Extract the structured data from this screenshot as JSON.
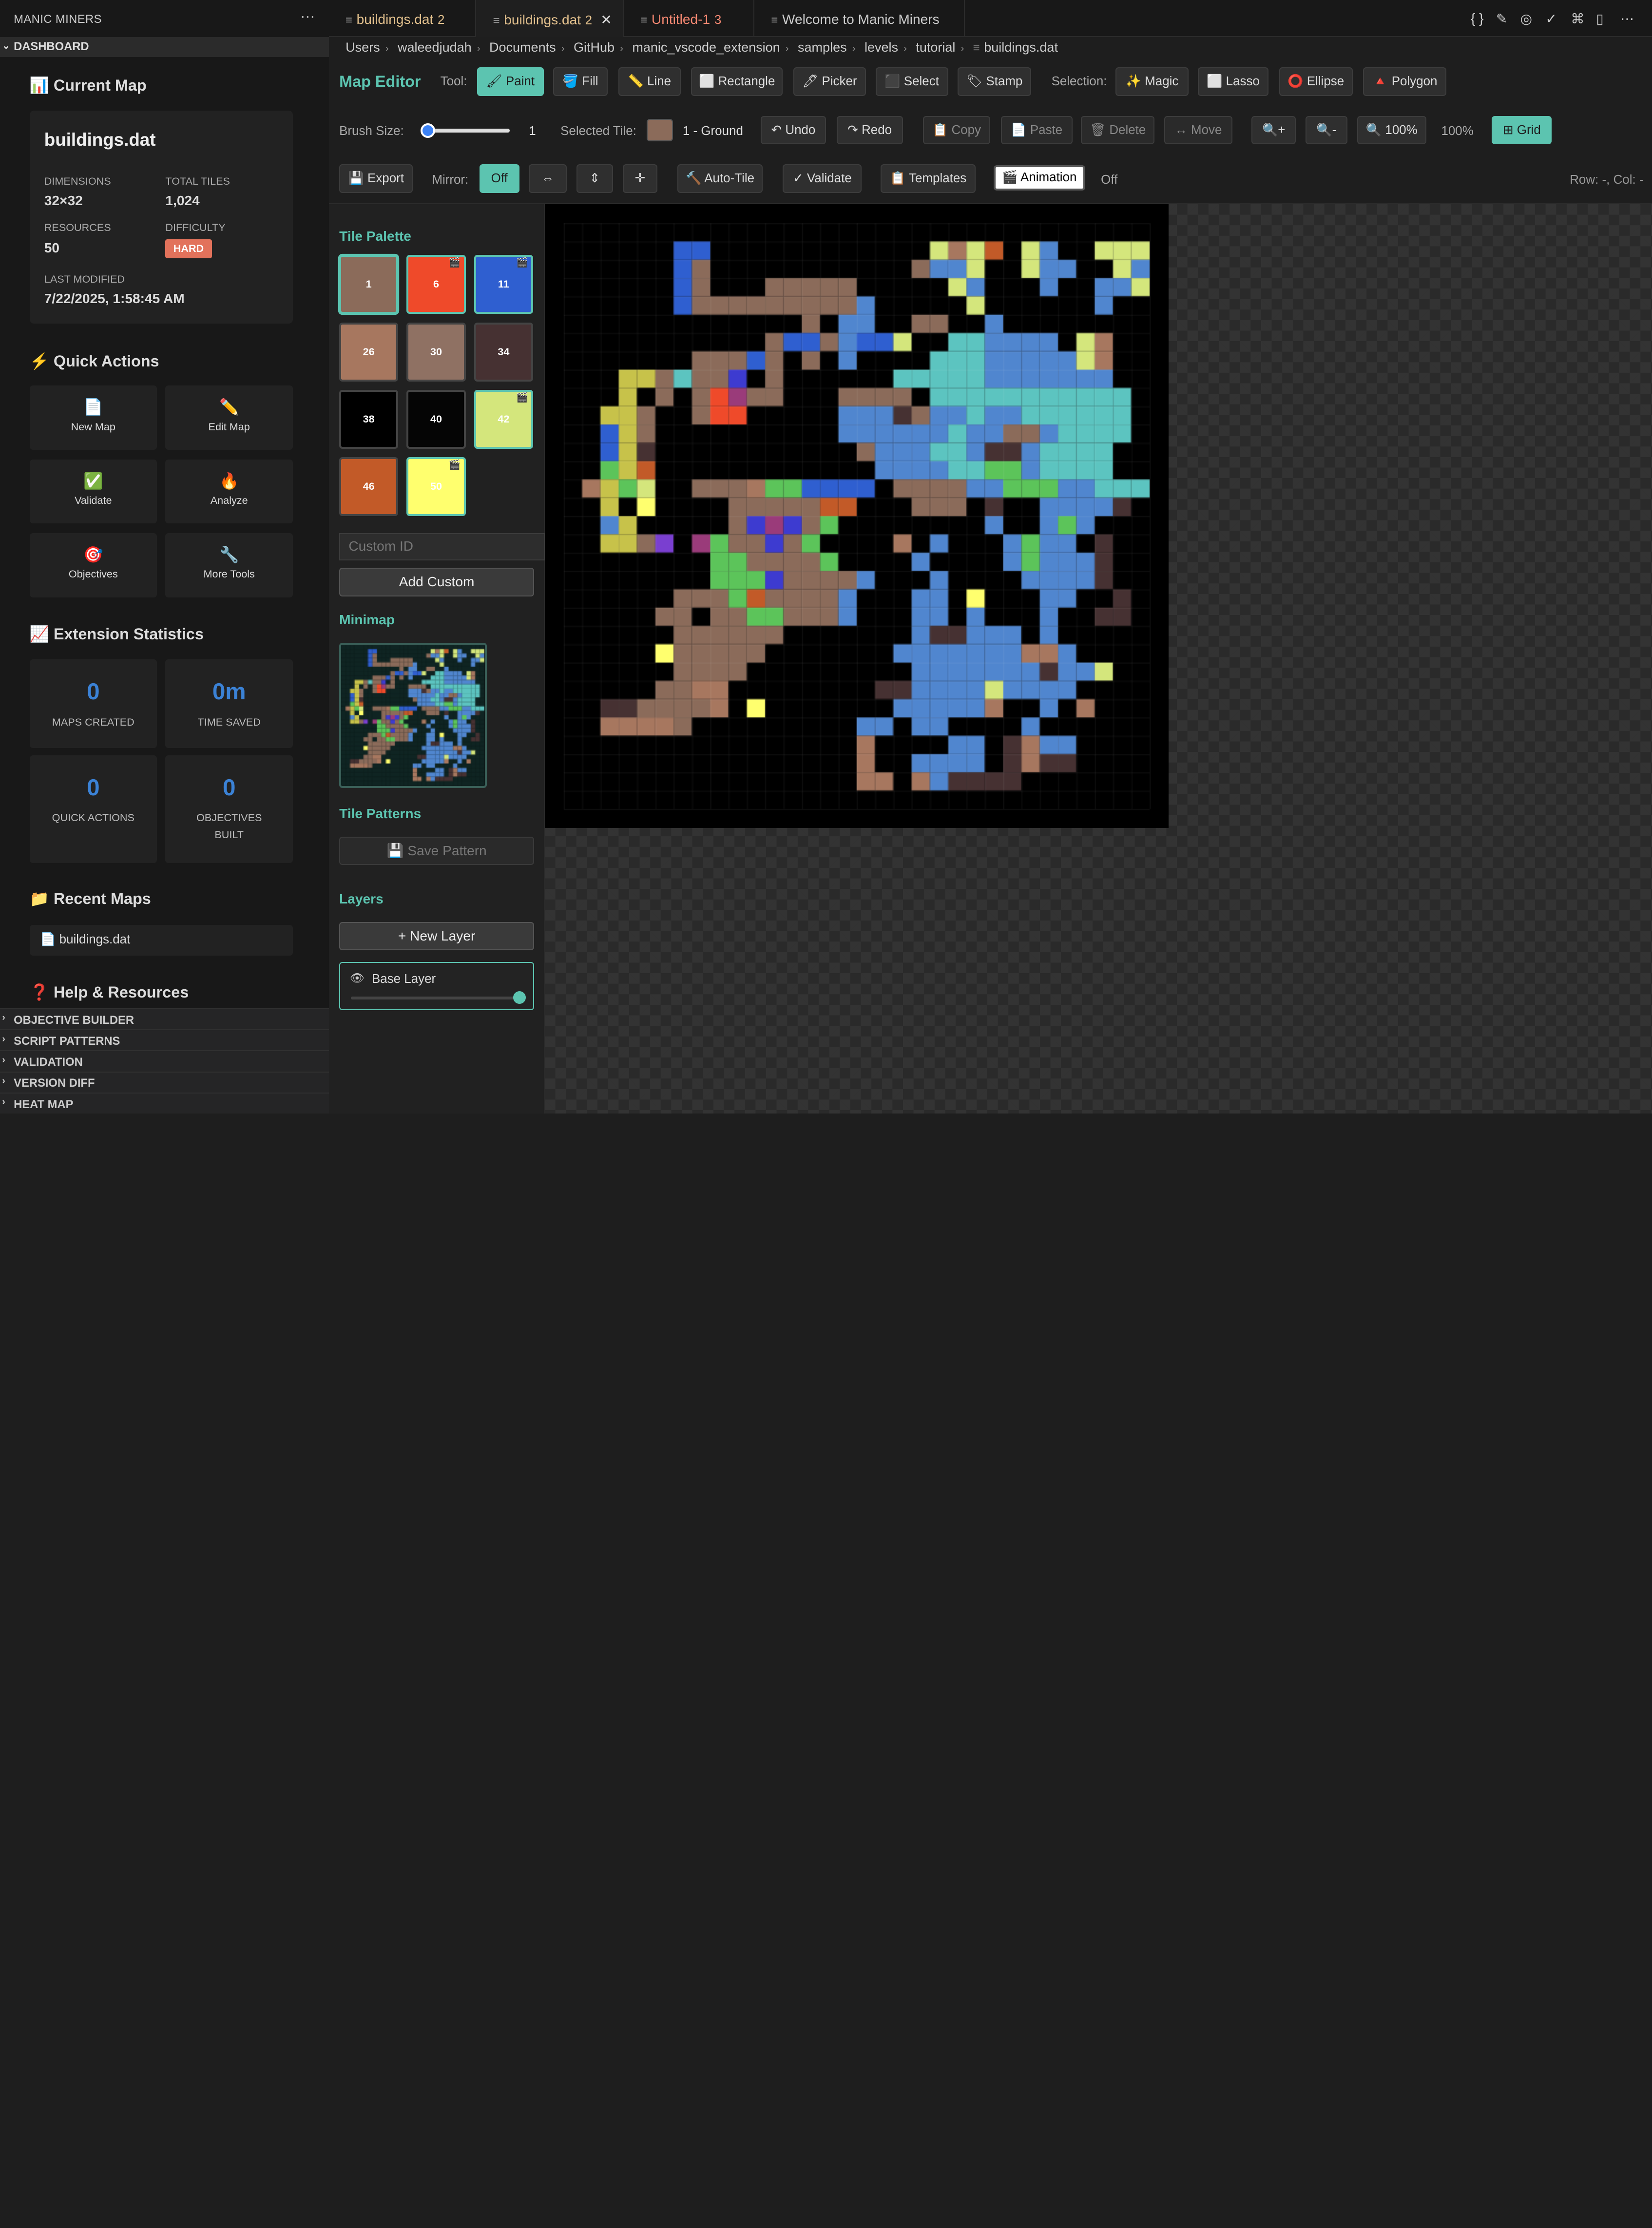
{
  "sidebar": {
    "title": "MANIC MINERS",
    "more": "···",
    "section": "DASHBOARD",
    "current_map": {
      "heading": "📊 Current Map",
      "name": "buildings.dat",
      "dimensions_label": "DIMENSIONS",
      "dimensions": "32×32",
      "total_tiles_label": "TOTAL TILES",
      "total_tiles": "1,024",
      "resources_label": "RESOURCES",
      "resources": "50",
      "difficulty_label": "DIFFICULTY",
      "difficulty": "HARD",
      "last_modified_label": "LAST MODIFIED",
      "last_modified": "7/22/2025, 1:58:45 AM"
    },
    "quick_actions": {
      "heading": "⚡ Quick Actions",
      "items": [
        {
          "icon": "📄",
          "label": "New Map"
        },
        {
          "icon": "✏️",
          "label": "Edit Map"
        },
        {
          "icon": "✅",
          "label": "Validate"
        },
        {
          "icon": "🔥",
          "label": "Analyze"
        },
        {
          "icon": "🎯",
          "label": "Objectives"
        },
        {
          "icon": "🔧",
          "label": "More Tools"
        }
      ]
    },
    "stats": {
      "heading": "📈 Extension Statistics",
      "items": [
        {
          "value": "0",
          "label": "MAPS CREATED"
        },
        {
          "value": "0m",
          "label": "TIME SAVED"
        },
        {
          "value": "0",
          "label": "QUICK ACTIONS"
        },
        {
          "value": "0",
          "label": "OBJECTIVES BUILT"
        }
      ]
    },
    "recent": {
      "heading": "📁 Recent Maps",
      "items": [
        "📄 buildings.dat"
      ]
    },
    "help_heading": "❓ Help & Resources",
    "collapsed_sections": [
      "OBJECTIVE BUILDER",
      "SCRIPT PATTERNS",
      "VALIDATION",
      "VERSION DIFF",
      "HEAT MAP"
    ]
  },
  "tabs": [
    {
      "label": "buildings.dat",
      "badge": "2",
      "color": "#e2c08d"
    },
    {
      "label": "buildings.dat",
      "badge": "2",
      "color": "#e2c08d",
      "close": "✕"
    },
    {
      "label": "Untitled-1",
      "badge": "3",
      "color": "#f48771"
    },
    {
      "label": "Welcome to Manic Miners",
      "badge": "",
      "color": "#cccccc"
    }
  ],
  "top_icons": [
    "{ }",
    "✎",
    "◎",
    "✓",
    "⌘",
    "▯",
    "⋯"
  ],
  "breadcrumb": [
    "Users",
    "waleedjudah",
    "Documents",
    "GitHub",
    "manic_vscode_extension",
    "samples",
    "levels",
    "tutorial",
    "buildings.dat"
  ],
  "editor": {
    "title": "Map Editor",
    "tool_label": "Tool:",
    "tools": [
      "🖌 Paint",
      "🪣 Fill",
      "📏 Line",
      "⬜ Rectangle",
      "🖊 Picker",
      "⬛ Select",
      "🏷 Stamp"
    ],
    "selection_label": "Selection:",
    "selections": [
      "✨ Magic",
      "⬜ Lasso",
      "⭕ Ellipse",
      "🔺 Polygon"
    ],
    "brush_label": "Brush Size:",
    "brush_value": "1",
    "brush_level": 0.0,
    "selected_tile_label": "Selected Tile:",
    "selected_tile": "1 - Ground",
    "undo": "↶ Undo",
    "redo": "↷ Redo",
    "copy": "📋 Copy",
    "paste": "📄 Paste",
    "delete": "🗑 Delete",
    "move": "↔ Move",
    "zoom_in": "🔍+",
    "zoom_out": "🔍-",
    "zoom_reset": "🔍 100%",
    "zoom_level": "100%",
    "grid": "⊞ Grid",
    "export": "💾 Export",
    "mirror_label": "Mirror:",
    "mirror_off": "Off",
    "mirror_h": "⇔",
    "mirror_v": "⇕",
    "mirror_both": "✛",
    "autotile": "🔨 Auto-Tile",
    "validate": "✓ Validate",
    "templates": "📋 Templates",
    "animation": "🎬 Animation",
    "animation_state": "Off",
    "cursor_pos": "Row: -, Col: -"
  },
  "palette": {
    "heading": "Tile Palette",
    "tiles": [
      {
        "id": "1",
        "color": "#8b6b5a",
        "anim": false
      },
      {
        "id": "6",
        "color": "#ef4a2a",
        "anim": true
      },
      {
        "id": "11",
        "color": "#2f5fd0",
        "anim": true
      },
      {
        "id": "26",
        "color": "#a7775f",
        "anim": false
      },
      {
        "id": "30",
        "color": "#8f7163",
        "anim": false
      },
      {
        "id": "34",
        "color": "#463132",
        "anim": false
      },
      {
        "id": "38",
        "color": "#000000",
        "anim": false
      },
      {
        "id": "40",
        "color": "#050505",
        "anim": false
      },
      {
        "id": "42",
        "color": "#d4e67c",
        "anim": true
      },
      {
        "id": "46",
        "color": "#c25a28",
        "anim": false
      },
      {
        "id": "50",
        "color": "#ffff6e",
        "anim": true
      }
    ],
    "custom_placeholder": "Custom ID",
    "add_custom": "Add Custom"
  },
  "minimap_heading": "Minimap",
  "patterns": {
    "heading": "Tile Patterns",
    "save": "💾 Save Pattern"
  },
  "layers": {
    "heading": "Layers",
    "new": "+ New Layer",
    "items": [
      {
        "name": "Base Layer",
        "eye": "👁",
        "opacity": 1.0
      }
    ]
  },
  "map": {
    "size": 32,
    "colors": {
      "K": "#000000",
      "B": "#8b6b5a",
      "D": "#a7775f",
      "E": "#463132",
      "W": "#5086cf",
      "T": "#5cc4c0",
      "Y": "#d4e67c",
      "O": "#c25a28",
      "N": "#2f5fd0",
      "G": "#5cc45a",
      "L": "#c7c24a",
      "R": "#ef4a2a",
      "P": "#9a3b7a",
      "V": "#7a3fd0",
      "U": "#3d3bd0",
      "S": "#ffff6e"
    },
    "rows": [
      "KKKKKKKKKKKKKKKKKKKKKKKKKKKKKKKK",
      "KKKKKKNNKKKKKKKKKKKKYDYOKYWKKYYYK",
      "KKKKKKNBKKKKKKKKKKKBWWYKKYWWKKYWYK",
      "KKKKKKNBKKKBBBBBKKKKKYWKKKWKKWWYK",
      "KKKKKKNBBBBBBBBBWKKKKKYKKKKKKWKKK",
      "KKKKKKKKKKKKKBKWWKKBBKKWKKKKKKKK",
      "KKKKKKKKKKKBNNBWNNYKKTTWWWWKYDK",
      "KKKKKKKBBBNBKBKWKKKKTTTWWWWWYDK",
      "KKKLLBTBBUKBKKKKKKTTTTTWWWWWWWK",
      "KKKLKBKBRPBBKKKBBBBKTTTTTTTTTTTK",
      "KKLLBKKBRRKKKKKWWWEBWWTWWTTTTTTK",
      "KKNLBKKKKKKKKKKWWWWWWTWWBBWTTTTK",
      "KKNLEKKKKKKKKKKKBWWWTTWEEWTTTTK",
      "KKGLOKKKKKKKKKKKKWWWWTTGGWTTTTK",
      "KDLGYKKBBBDGGNNNNKBBBBWWGGGWWTTTK",
      "KKLKSKKKKBBBBBOOKKKBBBKEKKWWWWEK",
      "KKWLKKKKKBUPUBGKKKKKKKKWKKWGWKKK",
      "KKLLBVKPGBBUBGKKKKDKWKKKWGWWKEK",
      "KKKKKKKKGGBBBBGKKKKWKKKKWGWWWEK",
      "KKKKKKKKGGGUBBBBWKKKWKKKKWWWWEKK",
      "KKKKKKBBBGOBBBBWKKKWWKSKKKWWKKEK",
      "KKKKKBBKBBGGBBBWKKKWWKWKKKWKKEEK",
      "KKKKKKBBBBBBKKKKKKKWEEWWWKWKKKKK",
      "KKKKKSBBBBBKKKKKKKWWWWWWWDDWKKK",
      "KKKKKKBBBBKKKKKKKKKWWWWWWWEWWYKK",
      "KKKKKBBDDKKKKKKKKEEWWWWYWWWWKKKK",
      "KKEEBBBBDKSKKKKKKKWWWWWDKKWKDKKK",
      "KKDDDDBKKKKKKKKKWWKWWKKKKWKKKKKK",
      "KKKKKKKKKKKKKKKKDKKKKWWKEDWWKKKKK",
      "KKKKKKKKKKKKKKKKDKKWWWWKEDEEKKKKK",
      "KKKKKKKKKKKKKKKKDDKDWEEEEKKKKKKKK",
      "KKKKKKKKKKKKKKKKKKKKKKKKKKKKKKKK"
    ]
  }
}
